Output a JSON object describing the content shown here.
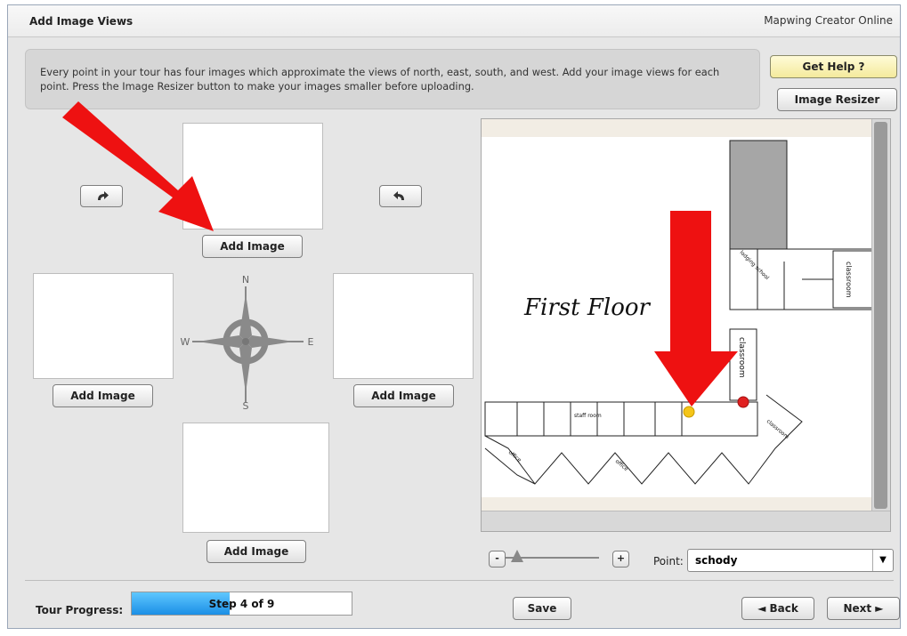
{
  "header": {
    "title": "Add Image Views",
    "app_name": "Mapwing Creator Online"
  },
  "info": {
    "text": "Every point in your tour has four images which approximate the views of north, east, south, and west. Add your image views for each point. Press the Image Resizer button to make your images smaller before uploading."
  },
  "buttons": {
    "get_help": "Get Help ?",
    "image_resizer": "Image Resizer",
    "add_image": "Add Image",
    "save": "Save",
    "back": "◄ Back",
    "next": "Next ►",
    "zoom_out": "-",
    "zoom_in": "+"
  },
  "compass": {
    "n": "N",
    "e": "E",
    "s": "S",
    "w": "W"
  },
  "map": {
    "floor_label": "First Floor",
    "room_labels": [
      "classroom",
      "classroom",
      "staff room",
      "lodging school",
      "office",
      "office",
      "classroom"
    ],
    "marker_colors": {
      "current": "#f5c518",
      "other": "#e02020"
    }
  },
  "point_selector": {
    "label": "Point:",
    "value": "schody"
  },
  "footer": {
    "progress_label": "Tour Progress:",
    "progress_text": "Step 4 of 9",
    "progress_fraction": 0.4444
  },
  "colors": {
    "arrow": "#ee1111",
    "progress_fill": "#1b8fe6"
  }
}
